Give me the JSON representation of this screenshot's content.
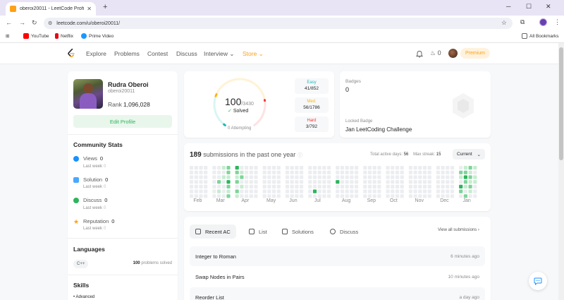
{
  "browser": {
    "tab_title": "oberoi20011 - LeetCode Profile",
    "url": "leetcode.com/u/oberoi20011/",
    "bookmarks": [
      "YouTube",
      "Netflix",
      "Prime Video"
    ],
    "all_bookmarks": "All Bookmarks"
  },
  "nav": {
    "items": [
      "Explore",
      "Problems",
      "Contest",
      "Discuss",
      "Interview",
      "Store"
    ],
    "streak": "0",
    "premium": "Premium"
  },
  "profile": {
    "name": "Rudra Oberoi",
    "handle": "oberoi20011",
    "rank_label": "Rank",
    "rank_value": "1,096,028",
    "edit_label": "Edit Profile"
  },
  "community": {
    "title": "Community Stats",
    "stats": [
      {
        "label": "Views",
        "value": "0",
        "sub": "Last week",
        "sub_value": "0",
        "color": "#1a90ff"
      },
      {
        "label": "Solution",
        "value": "0",
        "sub": "Last week",
        "sub_value": "0",
        "color": "#49a9ff"
      },
      {
        "label": "Discuss",
        "value": "0",
        "sub": "Last week",
        "sub_value": "0",
        "color": "#2db55d"
      },
      {
        "label": "Reputation",
        "value": "0",
        "sub": "Last week",
        "sub_value": "0",
        "color": "#ffa116"
      }
    ]
  },
  "languages": {
    "title": "Languages",
    "name": "C++",
    "count": "100",
    "count_suffix": "problems solved"
  },
  "skills": {
    "title": "Skills",
    "first": "Advanced"
  },
  "solved": {
    "count": "100",
    "total": "/3430",
    "label": "Solved",
    "attempting": "0 Attempting",
    "progress": 0.029,
    "difficulties": [
      {
        "name": "Easy",
        "count": "41/852",
        "color": "#1cbaba"
      },
      {
        "name": "Med.",
        "count": "56/1786",
        "color": "#ffb700"
      },
      {
        "name": "Hard",
        "count": "3/792",
        "color": "#f63737"
      }
    ]
  },
  "badges": {
    "title": "Badges",
    "count": "0",
    "locked_label": "Locked Badge",
    "locked_name": "Jan LeetCoding Challenge"
  },
  "submissions": {
    "count": "189",
    "text": "submissions in the past one year",
    "active_label": "Total active days:",
    "active_value": "56",
    "streak_label": "Max streak:",
    "streak_value": "15",
    "dropdown": "Current",
    "months": [
      "Feb",
      "Mar",
      "Apr",
      "May",
      "Jun",
      "Jul",
      "Aug",
      "Sep",
      "Oct",
      "Nov",
      "Dec",
      "Jan"
    ]
  },
  "recent": {
    "tabs": [
      "Recent AC",
      "List",
      "Solutions",
      "Discuss"
    ],
    "view_all": "View all submissions",
    "rows": [
      {
        "title": "Integer to Roman",
        "time": "6 minutes ago"
      },
      {
        "title": "Swap Nodes in Pairs",
        "time": "10 minutes ago"
      },
      {
        "title": "Reorder List",
        "time": "a day ago"
      }
    ]
  },
  "colors": {
    "accent": "#ffa116",
    "green": "#2db55d",
    "heat_empty": "#ebedf0"
  }
}
